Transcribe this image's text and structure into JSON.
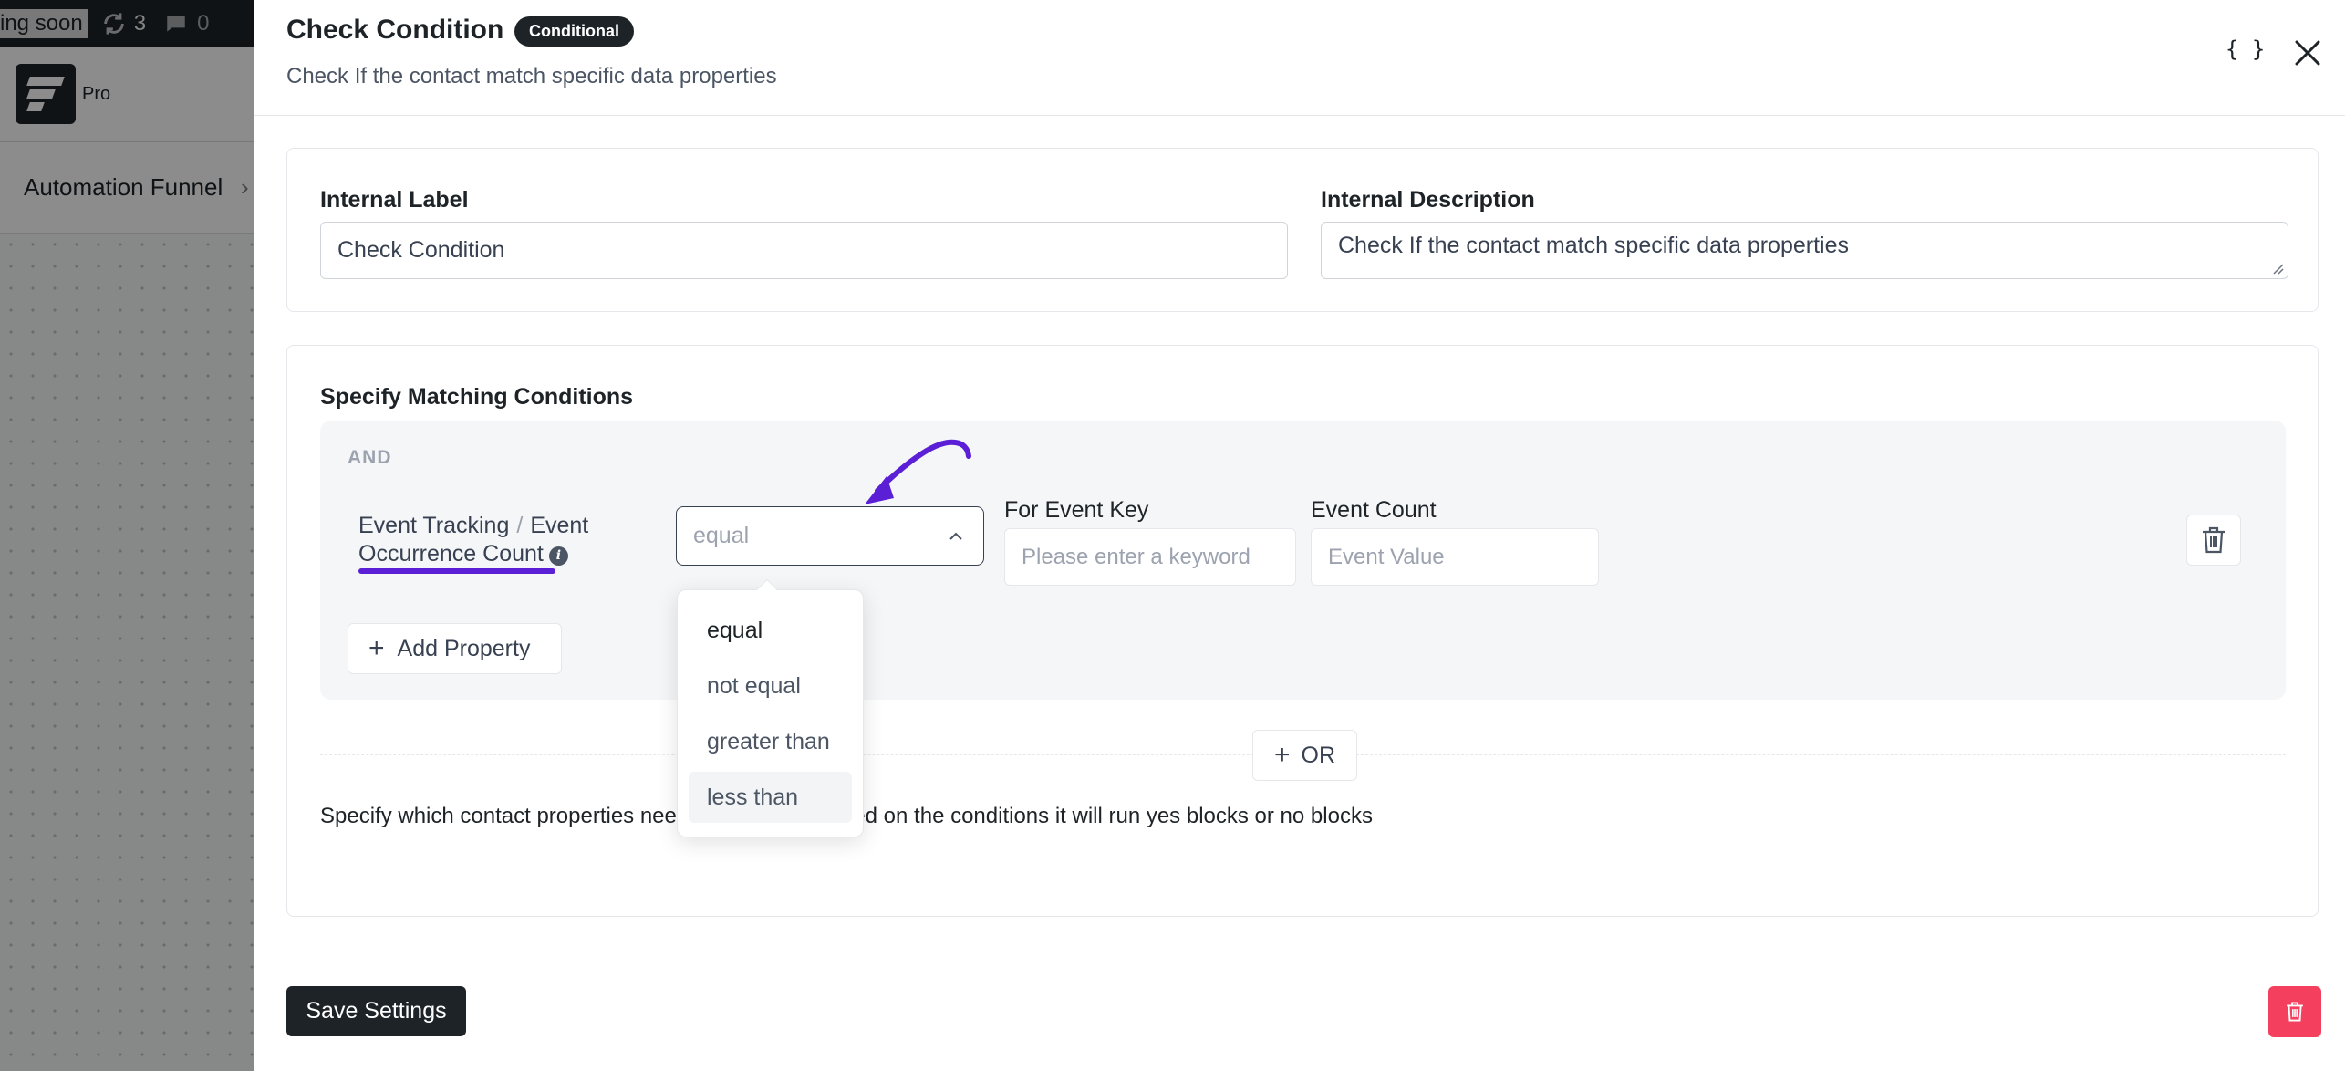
{
  "background": {
    "topbar": {
      "coming_soon": "ing soon",
      "updates_count": "3",
      "comments_count": "0"
    },
    "brand_label": "Pro",
    "breadcrumb": "Automation Funnel"
  },
  "drawer": {
    "title": "Check Condition",
    "badge": "Conditional",
    "subtitle": "Check If the contact match specific data properties",
    "json_icon_text": "{ }"
  },
  "labels_card": {
    "internal_label": {
      "title": "Internal Label",
      "value": "Check Condition"
    },
    "internal_description": {
      "title": "Internal Description",
      "value": "Check If the contact match specific data properties"
    }
  },
  "conditions": {
    "title": "Specify Matching Conditions",
    "group_operator": "AND",
    "rule": {
      "property_group": "Event Tracking",
      "separator": "/",
      "property_name_1": "Event",
      "property_name_2": "Occurrence Count",
      "info_icon": "i",
      "operator_placeholder": "equal",
      "event_key": {
        "title": "For Event Key",
        "placeholder": "Please enter a keyword"
      },
      "event_count": {
        "title": "Event Count",
        "placeholder": "Event Value"
      }
    },
    "add_property_label": "Add Property",
    "or_label": "OR",
    "help_text": "Specify which contact properties need to matched. Based on the conditions it will run yes blocks or no blocks"
  },
  "operator_dropdown": {
    "options": [
      "equal",
      "not equal",
      "greater than",
      "less than"
    ],
    "selected": "equal",
    "hovered": "less than"
  },
  "footer": {
    "save_label": "Save Settings"
  },
  "colors": {
    "annotation": "#5b1fd6",
    "danger": "#f43f5e",
    "dark": "#1d2327"
  }
}
